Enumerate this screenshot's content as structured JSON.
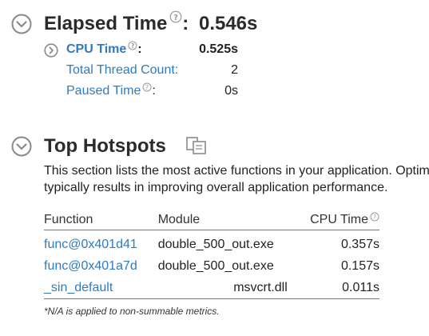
{
  "summary": {
    "elapsed": {
      "label": "Elapsed Time",
      "colon": ":",
      "value": "0.546s"
    },
    "metrics": [
      {
        "label": "CPU Time",
        "colon": ":",
        "value": "0.525s"
      },
      {
        "label": "Total Thread Count",
        "colon": ":",
        "value": "2"
      },
      {
        "label": "Paused Time",
        "colon": ":",
        "value": "0s"
      }
    ]
  },
  "hotspots": {
    "title": "Top Hotspots",
    "description_line1": "This section lists the most active functions in your application. Optimizing these hotspot functions",
    "description_line2": "typically results in improving overall application performance.",
    "columns": [
      "Function",
      "Module",
      "CPU Time"
    ],
    "rows": [
      {
        "function": "func@0x401d41",
        "module": "double_500_out.exe",
        "cpu_time": "0.357s"
      },
      {
        "function": "func@0x401a7d",
        "module": "double_500_out.exe",
        "cpu_time": "0.157s"
      },
      {
        "function": "_sin_default",
        "module": "msvcrt.dll",
        "cpu_time": "0.011s"
      }
    ],
    "note": "*N/A is applied to non-summable metrics."
  },
  "colors": {
    "link": "#2f7bc0",
    "icon_gray": "#8a8a8a"
  },
  "icons": {
    "section_toggle": "chevron-down-circle-icon",
    "subsection_toggle": "chevron-right-circle-icon",
    "help": "question-circle-icon",
    "copy": "copy-icon"
  }
}
